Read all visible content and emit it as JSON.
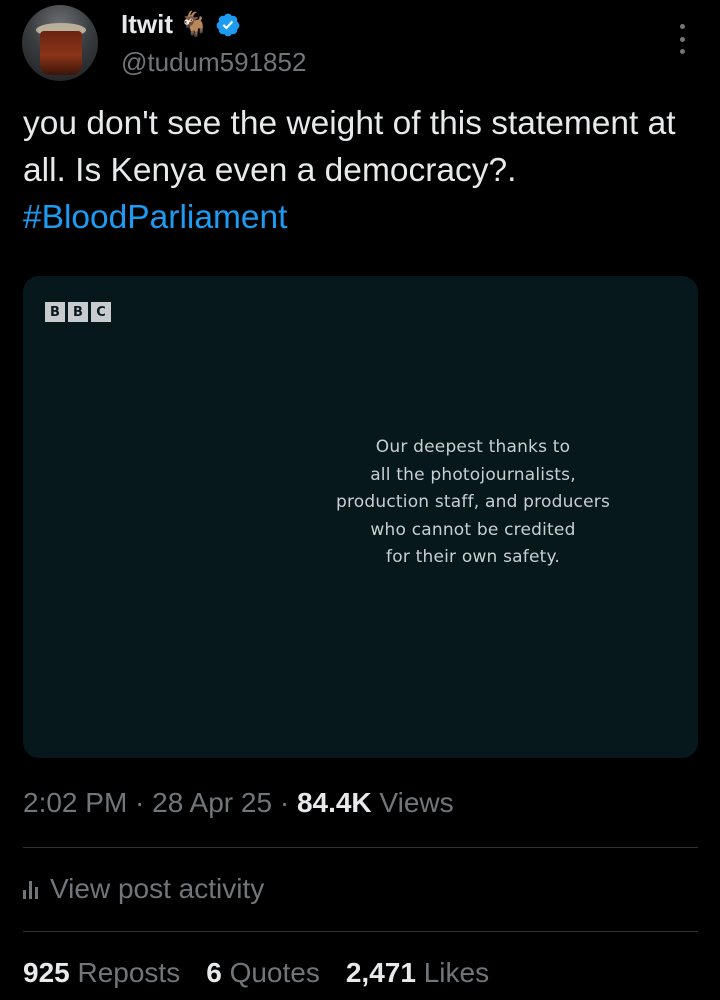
{
  "author": {
    "display_name": "Itwit",
    "emoji": "🐐",
    "handle": "@tudum591852"
  },
  "tweet": {
    "text": "you don't see the weight of this statement at all. Is Kenya even a democracy?. ",
    "hashtag": "#BloodParliament"
  },
  "media": {
    "logo_letters": [
      "B",
      "B",
      "C"
    ],
    "lines": [
      "Our deepest thanks to",
      "all the photojournalists,",
      "production staff, and producers",
      "who cannot be credited",
      "for their own safety."
    ]
  },
  "meta": {
    "time": "2:02 PM",
    "separator": " · ",
    "date": "28 Apr 25",
    "views_count": "84.4K",
    "views_label": " Views"
  },
  "activity": {
    "label": "View post activity"
  },
  "stats": {
    "reposts_count": "925",
    "reposts_label": " Reposts",
    "quotes_count": "6",
    "quotes_label": " Quotes",
    "likes_count": "2,471",
    "likes_label": " Likes"
  },
  "colors": {
    "background": "#000000",
    "text": "#e7e9ea",
    "muted": "#71767b",
    "accent": "#1d9bf0",
    "media_bg": "#07181d"
  }
}
